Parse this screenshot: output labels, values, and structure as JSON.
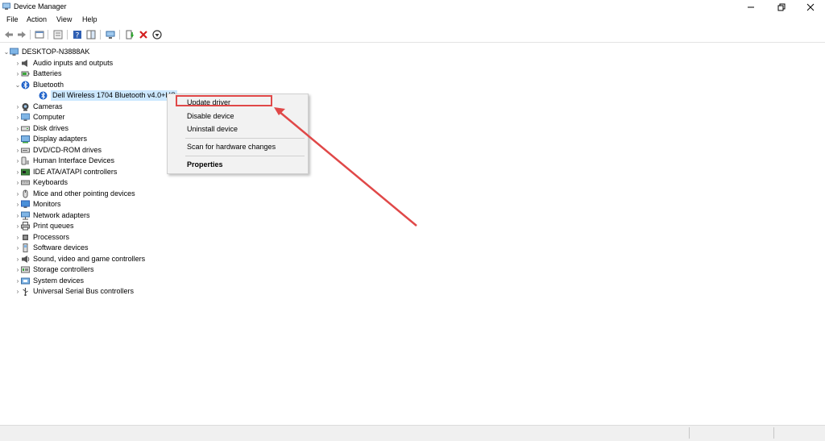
{
  "window": {
    "title": "Device Manager",
    "icons": {
      "app": "device-manager-icon",
      "minimize": "minimize-icon",
      "restore": "restore-icon",
      "close": "close-icon"
    }
  },
  "menu": [
    "File",
    "Action",
    "View",
    "Help"
  ],
  "toolbar": [
    "back-arrow-icon",
    "forward-arrow-icon",
    "properties-icon",
    "show-hidden-icon",
    "help-icon",
    "action-pane-icon",
    "scan-hardware-icon",
    "update-driver-icon",
    "uninstall-icon",
    "disable-icon"
  ],
  "tree": {
    "root": "DESKTOP-N3888AK",
    "categories": [
      {
        "label": "Audio inputs and outputs",
        "icon": "speaker-icon",
        "expanded": false
      },
      {
        "label": "Batteries",
        "icon": "battery-icon",
        "expanded": false
      },
      {
        "label": "Bluetooth",
        "icon": "bluetooth-icon",
        "expanded": true,
        "children": [
          "Dell Wireless 1704 Bluetooth v4.0+HS"
        ]
      },
      {
        "label": "Cameras",
        "icon": "camera-icon",
        "expanded": false
      },
      {
        "label": "Computer",
        "icon": "computer-icon",
        "expanded": false
      },
      {
        "label": "Disk drives",
        "icon": "disk-drive-icon",
        "expanded": false
      },
      {
        "label": "Display adapters",
        "icon": "display-adapter-icon",
        "expanded": false
      },
      {
        "label": "DVD/CD-ROM drives",
        "icon": "dvd-drive-icon",
        "expanded": false
      },
      {
        "label": "Human Interface Devices",
        "icon": "hid-icon",
        "expanded": false
      },
      {
        "label": "IDE ATA/ATAPI controllers",
        "icon": "ide-controller-icon",
        "expanded": false
      },
      {
        "label": "Keyboards",
        "icon": "keyboard-icon",
        "expanded": false
      },
      {
        "label": "Mice and other pointing devices",
        "icon": "mouse-icon",
        "expanded": false
      },
      {
        "label": "Monitors",
        "icon": "monitor-icon",
        "expanded": false
      },
      {
        "label": "Network adapters",
        "icon": "network-adapter-icon",
        "expanded": false
      },
      {
        "label": "Print queues",
        "icon": "printer-icon",
        "expanded": false
      },
      {
        "label": "Processors",
        "icon": "processor-icon",
        "expanded": false
      },
      {
        "label": "Software devices",
        "icon": "software-device-icon",
        "expanded": false
      },
      {
        "label": "Sound, video and game controllers",
        "icon": "sound-controller-icon",
        "expanded": false
      },
      {
        "label": "Storage controllers",
        "icon": "storage-controller-icon",
        "expanded": false
      },
      {
        "label": "System devices",
        "icon": "system-device-icon",
        "expanded": false
      },
      {
        "label": "Universal Serial Bus controllers",
        "icon": "usb-icon",
        "expanded": false
      }
    ]
  },
  "context_menu": {
    "items": [
      "Update driver",
      "Disable device",
      "Uninstall device",
      "Scan for hardware changes",
      "Properties"
    ],
    "highlighted": "Update driver"
  },
  "colors": {
    "annotation": "#e04848",
    "selection": "#cce8ff",
    "menu_bg": "#f2f2f2"
  }
}
